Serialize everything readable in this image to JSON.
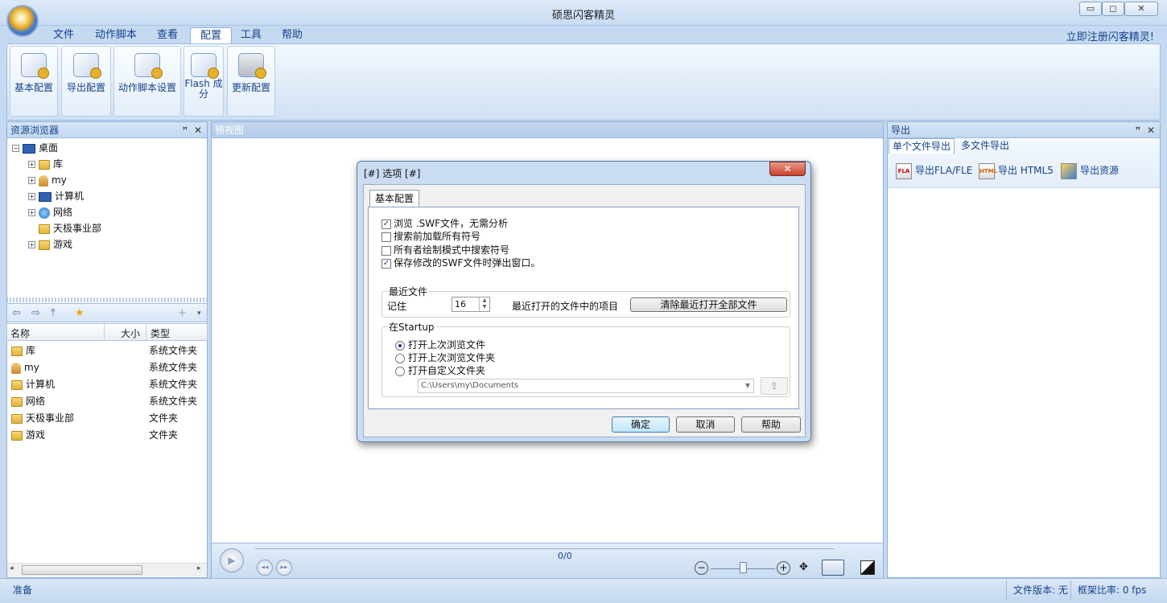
{
  "window": {
    "title": "硕思闪客精灵",
    "min": "▭",
    "max": "◻",
    "close": "✕"
  },
  "menu": [
    "文件",
    "动作脚本",
    "查看",
    "配置",
    "工具",
    "帮助"
  ],
  "register_link": "立即注册闪客精灵!",
  "ribbon": {
    "buttons": [
      "基本配置",
      "导出配置",
      "动作脚本设置",
      "Flash 成分",
      "更新配置"
    ]
  },
  "left_panel": {
    "title": "资源浏览器",
    "tree": {
      "root": "桌面",
      "children": [
        "库",
        "my",
        "计算机",
        "网络",
        "天极事业部",
        "游戏"
      ]
    },
    "list": {
      "columns": [
        "名称",
        "大小",
        "类型"
      ],
      "rows": [
        {
          "name": "库",
          "type": "系统文件夹"
        },
        {
          "name": "my",
          "type": "系统文件夹"
        },
        {
          "name": "计算机",
          "type": "系统文件夹"
        },
        {
          "name": "网络",
          "type": "系统文件夹"
        },
        {
          "name": "天极事业部",
          "type": "文件夹"
        },
        {
          "name": "游戏",
          "type": "文件夹"
        }
      ]
    }
  },
  "center": {
    "title": "预视图",
    "frame_counter": "0/0"
  },
  "right_panel": {
    "title": "导出",
    "tabs": [
      "单个文件导出",
      "多文件导出"
    ],
    "buttons": [
      {
        "label": "导出FLA/FLE",
        "icon": "FLA"
      },
      {
        "label": "导出 HTML5",
        "icon": "HTML"
      },
      {
        "label": "导出资源",
        "icon": ""
      }
    ]
  },
  "status": {
    "left": "准备",
    "file_version": "文件版本: 无",
    "frame_rate": "框架比率: 0 fps"
  },
  "dialog": {
    "title": "[#] 选项 [#]",
    "tab": "基本配置",
    "checkboxes": [
      {
        "label": "浏览 .SWF文件，无需分析",
        "checked": true
      },
      {
        "label": "搜索前加载所有符号",
        "checked": false
      },
      {
        "label": "所有者绘制模式中搜索符号",
        "checked": false
      },
      {
        "label": "保存修改的SWF文件时弹出窗口。",
        "checked": true
      }
    ],
    "recent": {
      "group": "最近文件",
      "remember_label": "记住",
      "count": "16",
      "suffix": "最近打开的文件中的项目",
      "clear_button": "清除最近打开全部文件"
    },
    "startup": {
      "group": "在Startup",
      "options": [
        {
          "label": "打开上次浏览文件",
          "selected": true
        },
        {
          "label": "打开上次浏览文件夹",
          "selected": false
        },
        {
          "label": "打开自定义文件夹",
          "selected": false
        }
      ],
      "path": "C:\\Users\\my\\Documents"
    },
    "buttons": {
      "ok": "确定",
      "cancel": "取消",
      "help": "帮助"
    }
  }
}
